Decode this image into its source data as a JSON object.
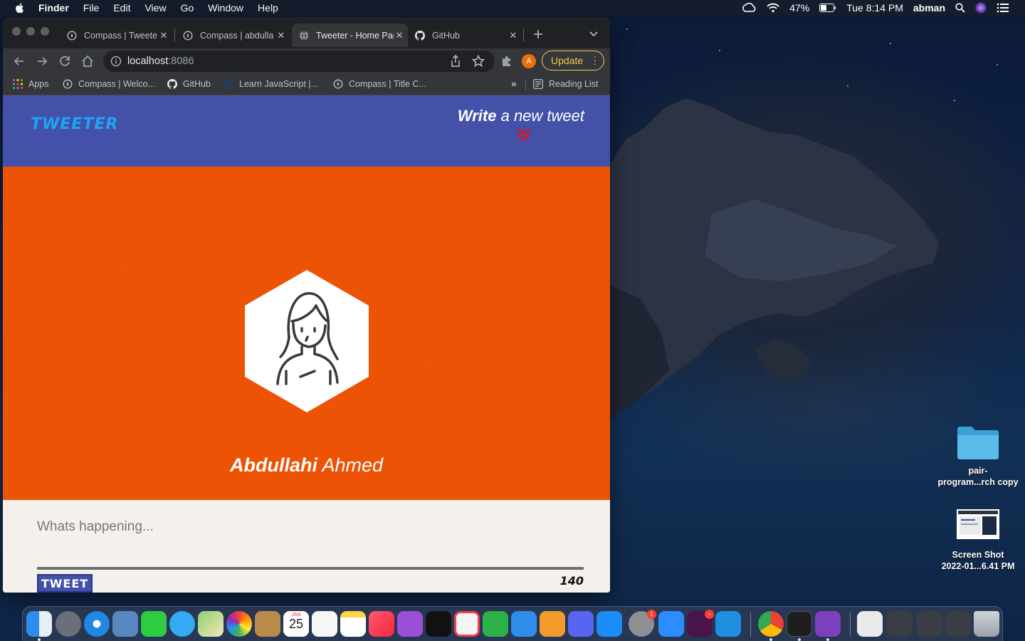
{
  "menubar": {
    "app_name": "Finder",
    "menus": [
      "File",
      "Edit",
      "View",
      "Go",
      "Window",
      "Help"
    ],
    "battery": "47%",
    "clock": "Tue 8:14 PM",
    "user": "abman"
  },
  "browser": {
    "tabs": [
      {
        "title": "Compass | Tweeter"
      },
      {
        "title": "Compass | abdulla"
      },
      {
        "title": "Tweeter - Home Page"
      },
      {
        "title": "GitHub"
      }
    ],
    "url_host": "localhost",
    "url_port": ":8086",
    "profile_initial": "A",
    "update_label": "Update",
    "bookmarks": [
      "Apps",
      "Compass | Welco...",
      "GitHub",
      "Learn JavaScript |...",
      "Compass | Title C..."
    ],
    "overflow": "»",
    "reading_list": "Reading List"
  },
  "page": {
    "logo": "TWEETER",
    "write_strong": "Write",
    "write_rest": " a new tweet",
    "profile_first_name": "Abdullahi",
    "profile_last_name": " Ahmed",
    "tweet_placeholder": "Whats happening...",
    "tweet_button": "TWEET",
    "counter": "140"
  },
  "desktop": {
    "icons": [
      {
        "label_line1": "pair-",
        "label_line2": "program...rch copy"
      },
      {
        "label_line1": "Screen Shot",
        "label_line2": "2022-01...6.41 PM"
      }
    ]
  },
  "dock": {
    "calendar_month": "JAN",
    "calendar_day": "25",
    "badge_sysprefs": "1",
    "badge_slack": "•"
  },
  "colors": {
    "nav_bg": "#4352a8",
    "logo": "#1fa4f4",
    "hero_bg": "#ec5304",
    "compose_bg": "#f4f1ec",
    "update_accent": "#f2c94c",
    "chevron": "#e0141e"
  }
}
